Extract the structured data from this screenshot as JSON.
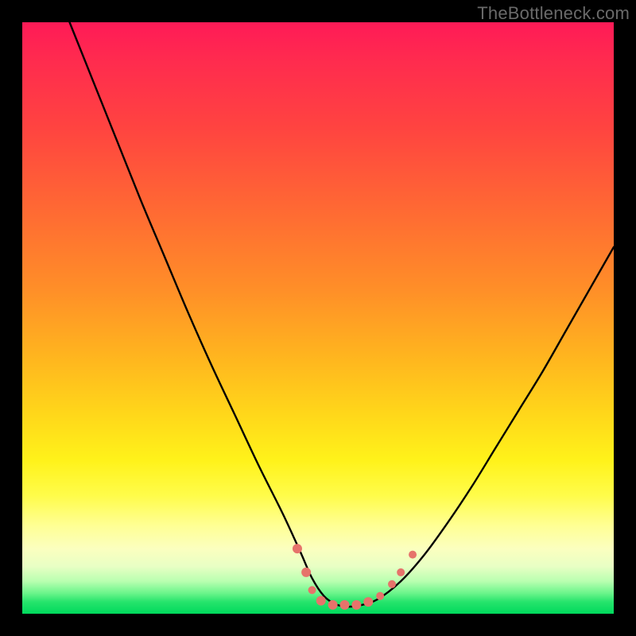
{
  "watermark": "TheBottleneck.com",
  "chart_data": {
    "type": "line",
    "title": "",
    "xlabel": "",
    "ylabel": "",
    "xlim": [
      0,
      100
    ],
    "ylim": [
      0,
      100
    ],
    "grid": false,
    "series": [
      {
        "name": "bottleneck-curve",
        "x": [
          8,
          12,
          16,
          20,
          24,
          28,
          32,
          36,
          40,
          44,
          47,
          49,
          51,
          53,
          55,
          57,
          60,
          64,
          68,
          72,
          76,
          80,
          84,
          88,
          92,
          96,
          100
        ],
        "values": [
          100,
          90,
          80,
          70,
          60.5,
          51,
          42,
          33.5,
          25,
          17,
          10.5,
          6,
          3,
          1.6,
          1.2,
          1.4,
          2.4,
          5.5,
          10,
          15.5,
          21.5,
          28,
          34.5,
          41,
          48,
          55,
          62
        ]
      }
    ],
    "markers": {
      "name": "highlight-dots",
      "color": "#e6736b",
      "points": [
        {
          "x": 46.5,
          "y": 11,
          "r": 6
        },
        {
          "x": 48.0,
          "y": 7,
          "r": 6
        },
        {
          "x": 49.0,
          "y": 4,
          "r": 5
        },
        {
          "x": 50.5,
          "y": 2.2,
          "r": 6
        },
        {
          "x": 52.5,
          "y": 1.5,
          "r": 6
        },
        {
          "x": 54.5,
          "y": 1.5,
          "r": 6
        },
        {
          "x": 56.5,
          "y": 1.5,
          "r": 6
        },
        {
          "x": 58.5,
          "y": 2.0,
          "r": 6
        },
        {
          "x": 60.5,
          "y": 3.0,
          "r": 5
        },
        {
          "x": 62.5,
          "y": 5.0,
          "r": 5
        },
        {
          "x": 64.0,
          "y": 7.0,
          "r": 5
        },
        {
          "x": 66.0,
          "y": 10.0,
          "r": 5
        }
      ]
    }
  }
}
